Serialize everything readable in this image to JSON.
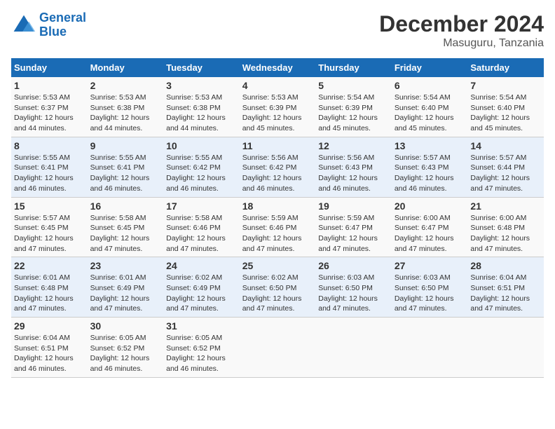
{
  "header": {
    "logo_text_general": "General",
    "logo_text_blue": "Blue",
    "month_title": "December 2024",
    "location": "Masuguru, Tanzania"
  },
  "calendar": {
    "days_of_week": [
      "Sunday",
      "Monday",
      "Tuesday",
      "Wednesday",
      "Thursday",
      "Friday",
      "Saturday"
    ],
    "weeks": [
      [
        {
          "day": "1",
          "sunrise": "5:53 AM",
          "sunset": "6:37 PM",
          "daylight": "12 hours and 44 minutes."
        },
        {
          "day": "2",
          "sunrise": "5:53 AM",
          "sunset": "6:38 PM",
          "daylight": "12 hours and 44 minutes."
        },
        {
          "day": "3",
          "sunrise": "5:53 AM",
          "sunset": "6:38 PM",
          "daylight": "12 hours and 44 minutes."
        },
        {
          "day": "4",
          "sunrise": "5:53 AM",
          "sunset": "6:39 PM",
          "daylight": "12 hours and 45 minutes."
        },
        {
          "day": "5",
          "sunrise": "5:54 AM",
          "sunset": "6:39 PM",
          "daylight": "12 hours and 45 minutes."
        },
        {
          "day": "6",
          "sunrise": "5:54 AM",
          "sunset": "6:40 PM",
          "daylight": "12 hours and 45 minutes."
        },
        {
          "day": "7",
          "sunrise": "5:54 AM",
          "sunset": "6:40 PM",
          "daylight": "12 hours and 45 minutes."
        }
      ],
      [
        {
          "day": "8",
          "sunrise": "5:55 AM",
          "sunset": "6:41 PM",
          "daylight": "12 hours and 46 minutes."
        },
        {
          "day": "9",
          "sunrise": "5:55 AM",
          "sunset": "6:41 PM",
          "daylight": "12 hours and 46 minutes."
        },
        {
          "day": "10",
          "sunrise": "5:55 AM",
          "sunset": "6:42 PM",
          "daylight": "12 hours and 46 minutes."
        },
        {
          "day": "11",
          "sunrise": "5:56 AM",
          "sunset": "6:42 PM",
          "daylight": "12 hours and 46 minutes."
        },
        {
          "day": "12",
          "sunrise": "5:56 AM",
          "sunset": "6:43 PM",
          "daylight": "12 hours and 46 minutes."
        },
        {
          "day": "13",
          "sunrise": "5:57 AM",
          "sunset": "6:43 PM",
          "daylight": "12 hours and 46 minutes."
        },
        {
          "day": "14",
          "sunrise": "5:57 AM",
          "sunset": "6:44 PM",
          "daylight": "12 hours and 47 minutes."
        }
      ],
      [
        {
          "day": "15",
          "sunrise": "5:57 AM",
          "sunset": "6:45 PM",
          "daylight": "12 hours and 47 minutes."
        },
        {
          "day": "16",
          "sunrise": "5:58 AM",
          "sunset": "6:45 PM",
          "daylight": "12 hours and 47 minutes."
        },
        {
          "day": "17",
          "sunrise": "5:58 AM",
          "sunset": "6:46 PM",
          "daylight": "12 hours and 47 minutes."
        },
        {
          "day": "18",
          "sunrise": "5:59 AM",
          "sunset": "6:46 PM",
          "daylight": "12 hours and 47 minutes."
        },
        {
          "day": "19",
          "sunrise": "5:59 AM",
          "sunset": "6:47 PM",
          "daylight": "12 hours and 47 minutes."
        },
        {
          "day": "20",
          "sunrise": "6:00 AM",
          "sunset": "6:47 PM",
          "daylight": "12 hours and 47 minutes."
        },
        {
          "day": "21",
          "sunrise": "6:00 AM",
          "sunset": "6:48 PM",
          "daylight": "12 hours and 47 minutes."
        }
      ],
      [
        {
          "day": "22",
          "sunrise": "6:01 AM",
          "sunset": "6:48 PM",
          "daylight": "12 hours and 47 minutes."
        },
        {
          "day": "23",
          "sunrise": "6:01 AM",
          "sunset": "6:49 PM",
          "daylight": "12 hours and 47 minutes."
        },
        {
          "day": "24",
          "sunrise": "6:02 AM",
          "sunset": "6:49 PM",
          "daylight": "12 hours and 47 minutes."
        },
        {
          "day": "25",
          "sunrise": "6:02 AM",
          "sunset": "6:50 PM",
          "daylight": "12 hours and 47 minutes."
        },
        {
          "day": "26",
          "sunrise": "6:03 AM",
          "sunset": "6:50 PM",
          "daylight": "12 hours and 47 minutes."
        },
        {
          "day": "27",
          "sunrise": "6:03 AM",
          "sunset": "6:50 PM",
          "daylight": "12 hours and 47 minutes."
        },
        {
          "day": "28",
          "sunrise": "6:04 AM",
          "sunset": "6:51 PM",
          "daylight": "12 hours and 47 minutes."
        }
      ],
      [
        {
          "day": "29",
          "sunrise": "6:04 AM",
          "sunset": "6:51 PM",
          "daylight": "12 hours and 46 minutes."
        },
        {
          "day": "30",
          "sunrise": "6:05 AM",
          "sunset": "6:52 PM",
          "daylight": "12 hours and 46 minutes."
        },
        {
          "day": "31",
          "sunrise": "6:05 AM",
          "sunset": "6:52 PM",
          "daylight": "12 hours and 46 minutes."
        },
        null,
        null,
        null,
        null
      ]
    ]
  }
}
